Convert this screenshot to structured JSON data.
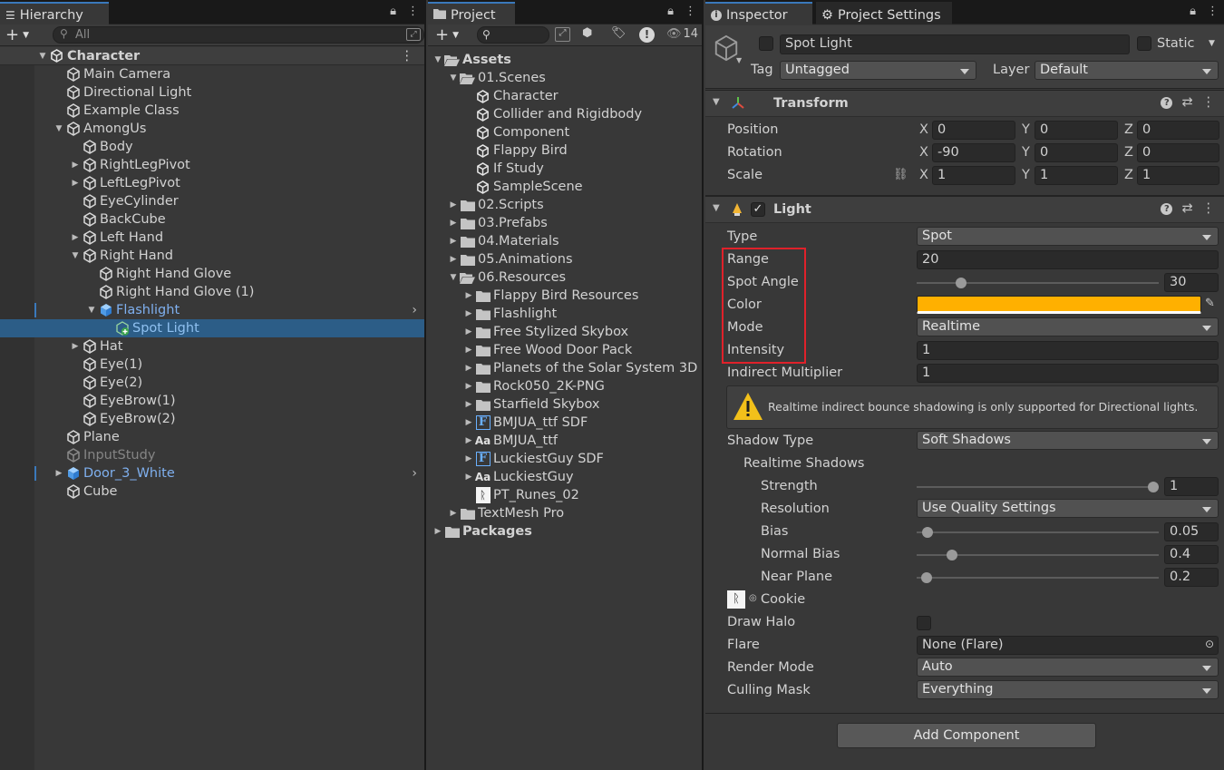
{
  "hierarchy": {
    "tab": "Hierarchy",
    "search_placeholder": "All",
    "scene": "Character",
    "items": [
      {
        "label": "Main Camera",
        "depth": 1,
        "arrow": "",
        "icon": "gameobject",
        "style": "normal"
      },
      {
        "label": "Directional Light",
        "depth": 1,
        "arrow": "",
        "icon": "gameobject",
        "style": "normal"
      },
      {
        "label": "Example Class",
        "depth": 1,
        "arrow": "",
        "icon": "gameobject",
        "style": "normal"
      },
      {
        "label": "AmongUs",
        "depth": 1,
        "arrow": "down",
        "icon": "gameobject",
        "style": "normal"
      },
      {
        "label": "Body",
        "depth": 2,
        "arrow": "",
        "icon": "gameobject",
        "style": "normal"
      },
      {
        "label": "RightLegPivot",
        "depth": 2,
        "arrow": "right",
        "icon": "gameobject",
        "style": "normal"
      },
      {
        "label": "LeftLegPivot",
        "depth": 2,
        "arrow": "right",
        "icon": "gameobject",
        "style": "normal"
      },
      {
        "label": "EyeCylinder",
        "depth": 2,
        "arrow": "",
        "icon": "gameobject",
        "style": "normal"
      },
      {
        "label": "BackCube",
        "depth": 2,
        "arrow": "",
        "icon": "gameobject",
        "style": "normal"
      },
      {
        "label": "Left Hand",
        "depth": 2,
        "arrow": "right",
        "icon": "gameobject",
        "style": "normal"
      },
      {
        "label": "Right Hand",
        "depth": 2,
        "arrow": "down",
        "icon": "gameobject",
        "style": "normal"
      },
      {
        "label": "Right Hand Glove",
        "depth": 3,
        "arrow": "",
        "icon": "gameobject",
        "style": "normal"
      },
      {
        "label": "Right Hand Glove (1)",
        "depth": 3,
        "arrow": "",
        "icon": "gameobject",
        "style": "normal"
      },
      {
        "label": "Flashlight",
        "depth": 3,
        "arrow": "down",
        "icon": "prefab",
        "style": "prefab"
      },
      {
        "label": "Spot Light",
        "depth": 4,
        "arrow": "",
        "icon": "prefab-added",
        "style": "selected"
      },
      {
        "label": "Hat",
        "depth": 2,
        "arrow": "right",
        "icon": "gameobject",
        "style": "normal"
      },
      {
        "label": "Eye(1)",
        "depth": 2,
        "arrow": "",
        "icon": "gameobject",
        "style": "normal"
      },
      {
        "label": "Eye(2)",
        "depth": 2,
        "arrow": "",
        "icon": "gameobject",
        "style": "normal"
      },
      {
        "label": "EyeBrow(1)",
        "depth": 2,
        "arrow": "",
        "icon": "gameobject",
        "style": "normal"
      },
      {
        "label": "EyeBrow(2)",
        "depth": 2,
        "arrow": "",
        "icon": "gameobject",
        "style": "normal"
      },
      {
        "label": "Plane",
        "depth": 1,
        "arrow": "",
        "icon": "gameobject",
        "style": "normal"
      },
      {
        "label": "InputStudy",
        "depth": 1,
        "arrow": "",
        "icon": "gameobject",
        "style": "disabled"
      },
      {
        "label": "Door_3_White",
        "depth": 1,
        "arrow": "right",
        "icon": "prefab",
        "style": "prefab"
      },
      {
        "label": "Cube",
        "depth": 1,
        "arrow": "",
        "icon": "gameobject",
        "style": "normal"
      }
    ]
  },
  "project": {
    "tab": "Project",
    "hidden_count": "14",
    "items": [
      {
        "label": "Assets",
        "depth": 0,
        "arrow": "down",
        "icon": "folder-open",
        "bold": true
      },
      {
        "label": "01.Scenes",
        "depth": 1,
        "arrow": "down",
        "icon": "folder-open",
        "bold": false
      },
      {
        "label": "Character",
        "depth": 2,
        "arrow": "",
        "icon": "scene",
        "bold": false
      },
      {
        "label": "Collider and Rigidbody",
        "depth": 2,
        "arrow": "",
        "icon": "scene",
        "bold": false
      },
      {
        "label": "Component",
        "depth": 2,
        "arrow": "",
        "icon": "scene",
        "bold": false
      },
      {
        "label": "Flappy Bird",
        "depth": 2,
        "arrow": "",
        "icon": "scene",
        "bold": false
      },
      {
        "label": "If Study",
        "depth": 2,
        "arrow": "",
        "icon": "scene",
        "bold": false
      },
      {
        "label": "SampleScene",
        "depth": 2,
        "arrow": "",
        "icon": "scene",
        "bold": false
      },
      {
        "label": "02.Scripts",
        "depth": 1,
        "arrow": "right",
        "icon": "folder",
        "bold": false
      },
      {
        "label": "03.Prefabs",
        "depth": 1,
        "arrow": "right",
        "icon": "folder",
        "bold": false
      },
      {
        "label": "04.Materials",
        "depth": 1,
        "arrow": "right",
        "icon": "folder",
        "bold": false
      },
      {
        "label": "05.Animations",
        "depth": 1,
        "arrow": "right",
        "icon": "folder",
        "bold": false
      },
      {
        "label": "06.Resources",
        "depth": 1,
        "arrow": "down",
        "icon": "folder-open",
        "bold": false
      },
      {
        "label": "Flappy Bird Resources",
        "depth": 2,
        "arrow": "right",
        "icon": "folder",
        "bold": false
      },
      {
        "label": "Flashlight",
        "depth": 2,
        "arrow": "right",
        "icon": "folder",
        "bold": false
      },
      {
        "label": "Free Stylized Skybox",
        "depth": 2,
        "arrow": "right",
        "icon": "folder",
        "bold": false
      },
      {
        "label": "Free Wood Door Pack",
        "depth": 2,
        "arrow": "right",
        "icon": "folder",
        "bold": false
      },
      {
        "label": "Planets of the Solar System 3D",
        "depth": 2,
        "arrow": "right",
        "icon": "folder",
        "bold": false
      },
      {
        "label": "Rock050_2K-PNG",
        "depth": 2,
        "arrow": "right",
        "icon": "folder",
        "bold": false
      },
      {
        "label": "Starfield Skybox",
        "depth": 2,
        "arrow": "right",
        "icon": "folder",
        "bold": false
      },
      {
        "label": "BMJUA_ttf SDF",
        "depth": 2,
        "arrow": "right",
        "icon": "font-asset",
        "bold": false
      },
      {
        "label": "BMJUA_ttf",
        "depth": 2,
        "arrow": "right",
        "icon": "font",
        "bold": false
      },
      {
        "label": "LuckiestGuy SDF",
        "depth": 2,
        "arrow": "right",
        "icon": "font-asset",
        "bold": false
      },
      {
        "label": "LuckiestGuy",
        "depth": 2,
        "arrow": "right",
        "icon": "font",
        "bold": false
      },
      {
        "label": "PT_Runes_02",
        "depth": 2,
        "arrow": "",
        "icon": "texture",
        "bold": false
      },
      {
        "label": "TextMesh Pro",
        "depth": 1,
        "arrow": "right",
        "icon": "folder",
        "bold": false
      },
      {
        "label": "Packages",
        "depth": 0,
        "arrow": "right",
        "icon": "folder",
        "bold": true
      }
    ]
  },
  "inspector": {
    "tab": "Inspector",
    "tab2": "Project Settings",
    "object_name": "Spot Light",
    "static_label": "Static",
    "tag_label": "Tag",
    "tag_value": "Untagged",
    "layer_label": "Layer",
    "layer_value": "Default",
    "transform": {
      "title": "Transform",
      "position_label": "Position",
      "rotation_label": "Rotation",
      "scale_label": "Scale",
      "axis": {
        "x": "X",
        "y": "Y",
        "z": "Z"
      },
      "position": {
        "x": "0",
        "y": "0",
        "z": "0"
      },
      "rotation": {
        "x": "-90",
        "y": "0",
        "z": "0"
      },
      "scale": {
        "x": "1",
        "y": "1",
        "z": "1"
      }
    },
    "light": {
      "title": "Light",
      "type_label": "Type",
      "type_value": "Spot",
      "range_label": "Range",
      "range_value": "20",
      "spot_angle_label": "Spot Angle",
      "spot_angle_value": "30",
      "spot_angle_fraction": 0.17,
      "color_label": "Color",
      "color_value": "#ffb000",
      "mode_label": "Mode",
      "mode_value": "Realtime",
      "intensity_label": "Intensity",
      "intensity_value": "1",
      "indirect_label": "Indirect Multiplier",
      "indirect_value": "1",
      "warning": "Realtime indirect bounce shadowing is only supported for Directional lights.",
      "shadow_type_label": "Shadow Type",
      "shadow_type_value": "Soft Shadows",
      "realtime_shadows_label": "Realtime Shadows",
      "strength_label": "Strength",
      "strength_value": "1",
      "strength_fraction": 1.0,
      "resolution_label": "Resolution",
      "resolution_value": "Use Quality Settings",
      "bias_label": "Bias",
      "bias_value": "0.05",
      "bias_fraction": 0.025,
      "normal_bias_label": "Normal Bias",
      "normal_bias_value": "0.4",
      "normal_bias_fraction": 0.13,
      "near_plane_label": "Near Plane",
      "near_plane_value": "0.2",
      "near_plane_fraction": 0.02,
      "cookie_label": "Cookie",
      "draw_halo_label": "Draw Halo",
      "flare_label": "Flare",
      "flare_value": "None (Flare)",
      "render_mode_label": "Render Mode",
      "render_mode_value": "Auto",
      "culling_mask_label": "Culling Mask",
      "culling_mask_value": "Everything"
    },
    "add_component": "Add Component"
  },
  "colors": {
    "highlight_box": "#e0212a",
    "prefab_text": "#7fb0ef",
    "selection": "#2c5d87",
    "accent_tab": "#3a79bb"
  }
}
